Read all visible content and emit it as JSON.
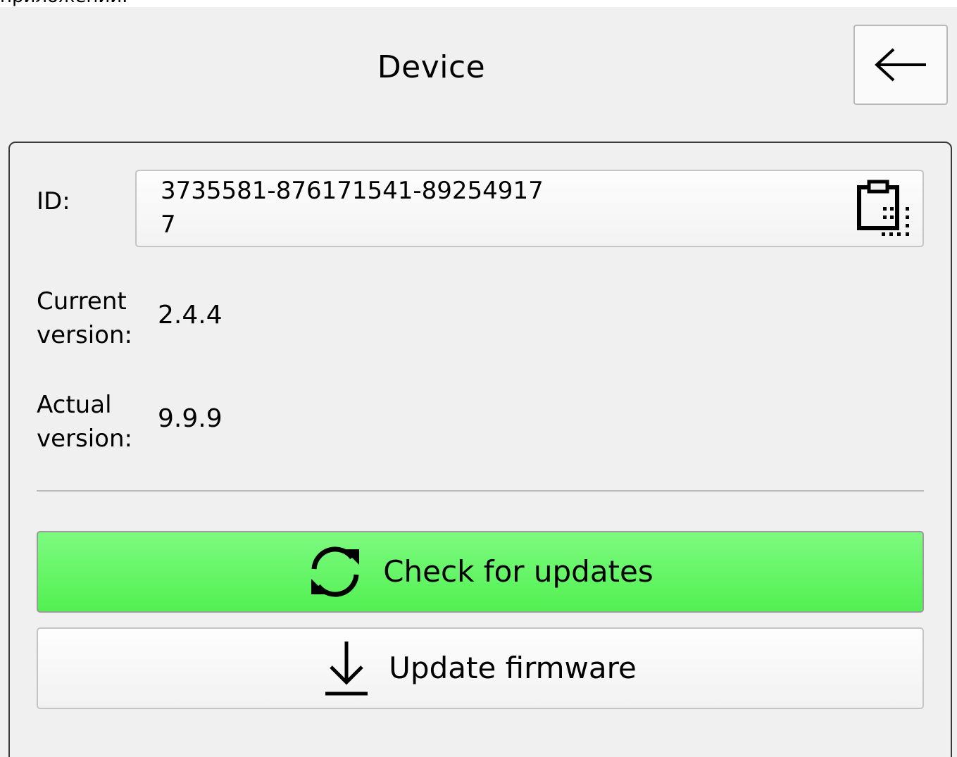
{
  "header": {
    "clipped_text": "приложении.",
    "title": "Device",
    "back_icon": "arrow-left-icon"
  },
  "device_info": {
    "id_label": "ID:",
    "id_value": "3735581-876171541-892549177",
    "copy_icon": "clipboard-icon",
    "current_version_label_line1": "Current",
    "current_version_label_line2": "version:",
    "current_version_value": "2.4.4",
    "actual_version_label_line1": "Actual",
    "actual_version_label_line2": "version:",
    "actual_version_value": "9.9.9"
  },
  "actions": {
    "check_label": "Check for updates",
    "check_icon": "refresh-icon",
    "update_label": "Update firmware",
    "update_icon": "download-icon"
  },
  "colors": {
    "check_button_top": "#7dfa80",
    "check_button_bottom": "#52f052",
    "background": "#f0f0f0"
  }
}
